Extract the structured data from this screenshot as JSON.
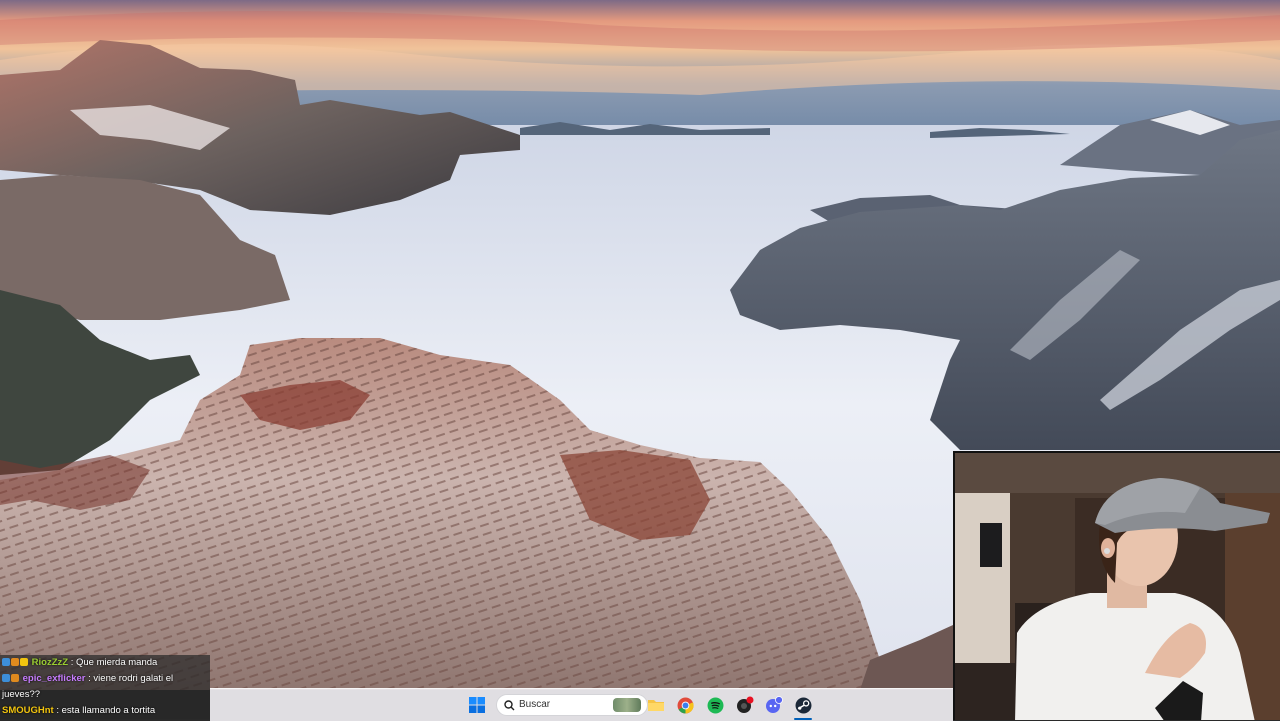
{
  "chat": {
    "messages": [
      {
        "user": "RiozZzZ",
        "separator": ":",
        "text": "Que mierda manda",
        "user_color": "#9acd32",
        "badges": [
          "#3d8ed8",
          "#e08a1e",
          "#f1c40f"
        ]
      },
      {
        "user": "epic_exflicker",
        "separator": ":",
        "text": "viene rodri galati el jueves??",
        "user_color": "#c77dff",
        "badges": [
          "#3d8ed8",
          "#e08a1e"
        ]
      },
      {
        "user": "SMOUGHnt",
        "separator": ":",
        "text": "esta llamando a tortita",
        "user_color": "#f1c40f",
        "badges": []
      }
    ]
  },
  "taskbar": {
    "start_icon": "windows-start-icon",
    "search": {
      "placeholder": "Buscar"
    },
    "pinned": [
      {
        "name": "file-explorer-icon",
        "color": "#f6c445"
      },
      {
        "name": "chrome-icon",
        "color": "#e14b3b"
      },
      {
        "name": "spotify-icon",
        "color": "#1db954"
      },
      {
        "name": "app-with-notification-icon",
        "color": "#222222"
      },
      {
        "name": "discord-icon",
        "color": "#5865f2"
      },
      {
        "name": "steam-icon",
        "color": "#1b2838"
      }
    ],
    "notification_badge_color": "#e81123"
  },
  "colors": {
    "accent": "#005fb8"
  }
}
